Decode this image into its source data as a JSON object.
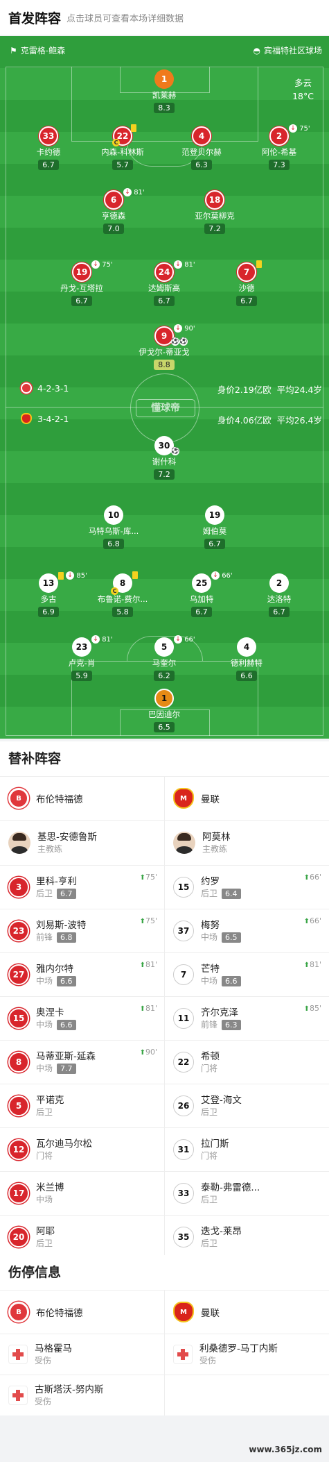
{
  "header": {
    "title": "首发阵容",
    "subtitle": "点击球员可查看本场详细数据"
  },
  "pitch": {
    "home_coach_label": "克雷格-鲍森",
    "venue": "宾福特社区球场",
    "weather": "多云",
    "temperature": "18°C",
    "watermark": "懂球帝",
    "home_formation": "4-2-3-1",
    "home_value": "身价2.19亿欧",
    "home_age": "平均24.4岁",
    "away_formation": "3-4-2-1",
    "away_value": "身价4.06亿欧",
    "away_age": "平均26.4岁"
  },
  "home_players": [
    {
      "num": "1",
      "name": "凯莱赫",
      "rating": "8.3"
    },
    {
      "num": "33",
      "name": "卡约德",
      "rating": "6.7"
    },
    {
      "num": "22",
      "name": "内森-科林斯",
      "rating": "5.7"
    },
    {
      "num": "4",
      "name": "范登贝尔赫",
      "rating": "6.3"
    },
    {
      "num": "2",
      "name": "阿伦-希基",
      "rating": "7.3",
      "event": "75'"
    },
    {
      "num": "6",
      "name": "亨德森",
      "rating": "7.0",
      "event": "81'"
    },
    {
      "num": "18",
      "name": "亚尔莫柳克",
      "rating": "7.2"
    },
    {
      "num": "19",
      "name": "丹戈-互塔拉",
      "rating": "6.7",
      "event": "75'"
    },
    {
      "num": "24",
      "name": "达姆斯高",
      "rating": "6.7",
      "event": "81'"
    },
    {
      "num": "7",
      "name": "沙德",
      "rating": "6.7"
    },
    {
      "num": "9",
      "name": "伊戈尔-蒂亚戈",
      "rating": "8.8",
      "event": "90'"
    }
  ],
  "away_players": [
    {
      "num": "30",
      "name": "谢什科",
      "rating": "7.2"
    },
    {
      "num": "10",
      "name": "马特乌斯-库...",
      "rating": "6.8"
    },
    {
      "num": "19",
      "name": "姆伯莫",
      "rating": "6.7"
    },
    {
      "num": "13",
      "name": "多古",
      "rating": "6.9",
      "event": "85'"
    },
    {
      "num": "8",
      "name": "布鲁诺-费尔...",
      "rating": "5.8"
    },
    {
      "num": "25",
      "name": "乌加特",
      "rating": "6.7",
      "event": "66'"
    },
    {
      "num": "2",
      "name": "达洛特",
      "rating": "6.7"
    },
    {
      "num": "23",
      "name": "卢克-肖",
      "rating": "5.9",
      "event": "81'"
    },
    {
      "num": "5",
      "name": "马奎尔",
      "rating": "6.2",
      "event": "66'"
    },
    {
      "num": "4",
      "name": "德利赫特",
      "rating": "6.6"
    },
    {
      "num": "1",
      "name": "巴因迪尔",
      "rating": "6.5"
    }
  ],
  "subs": {
    "title": "替补阵容",
    "home_team": "布伦特福德",
    "away_team": "曼联",
    "home_coach": {
      "name": "基思-安德鲁斯",
      "role": "主教练"
    },
    "away_coach": {
      "name": "阿莫林",
      "role": "主教练"
    },
    "rows": [
      [
        {
          "num": "3",
          "name": "里科-亨利",
          "pos": "后卫",
          "rating": "6.7",
          "time": "75'"
        },
        {
          "num": "15",
          "name": "约罗",
          "pos": "后卫",
          "rating": "6.4",
          "time": "66'"
        }
      ],
      [
        {
          "num": "23",
          "name": "刘易斯-波特",
          "pos": "前锋",
          "rating": "6.8",
          "time": "75'"
        },
        {
          "num": "37",
          "name": "梅努",
          "pos": "中场",
          "rating": "6.5",
          "time": "66'"
        }
      ],
      [
        {
          "num": "27",
          "name": "雅内尔特",
          "pos": "中场",
          "rating": "6.6",
          "time": "81'"
        },
        {
          "num": "7",
          "name": "芒特",
          "pos": "中场",
          "rating": "6.6",
          "time": "81'"
        }
      ],
      [
        {
          "num": "15",
          "name": "奥涅卡",
          "pos": "中场",
          "rating": "6.6",
          "time": "81'"
        },
        {
          "num": "11",
          "name": "齐尔克泽",
          "pos": "前锋",
          "rating": "6.3",
          "time": "85'"
        }
      ],
      [
        {
          "num": "8",
          "name": "马蒂亚斯-延森",
          "pos": "中场",
          "rating": "7.7",
          "time": "90'"
        },
        {
          "num": "22",
          "name": "希顿",
          "pos": "门将"
        }
      ],
      [
        {
          "num": "5",
          "name": "平诺克",
          "pos": "后卫"
        },
        {
          "num": "26",
          "name": "艾登-海文",
          "pos": "后卫"
        }
      ],
      [
        {
          "num": "12",
          "name": "瓦尔迪马尔松",
          "pos": "门将"
        },
        {
          "num": "31",
          "name": "拉门斯",
          "pos": "门将"
        }
      ],
      [
        {
          "num": "17",
          "name": "米兰博",
          "pos": "中场"
        },
        {
          "num": "33",
          "name": "泰勒-弗雷德...",
          "pos": "后卫"
        }
      ],
      [
        {
          "num": "20",
          "name": "阿耶",
          "pos": "后卫"
        },
        {
          "num": "35",
          "name": "迭戈-莱昂",
          "pos": "后卫"
        }
      ]
    ]
  },
  "injuries": {
    "title": "伤停信息",
    "home_team": "布伦特福德",
    "away_team": "曼联",
    "rows": [
      [
        {
          "name": "马格霍马",
          "status": "受伤"
        },
        {
          "name": "利桑德罗-马丁内斯",
          "status": "受伤"
        }
      ],
      [
        {
          "name": "古斯塔沃-努内斯",
          "status": "受伤"
        },
        null
      ]
    ]
  },
  "footer": "www.365jz.com"
}
